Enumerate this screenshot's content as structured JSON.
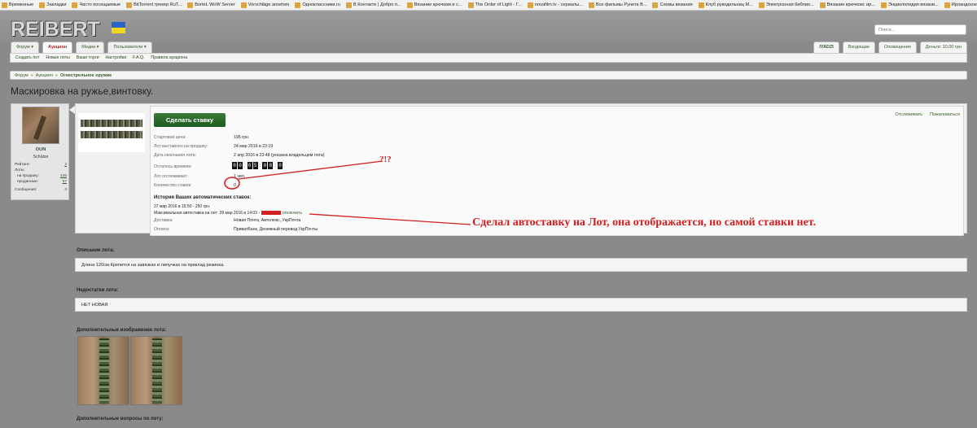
{
  "bookmarks": [
    "Временные",
    "Закладки",
    "Часто посещаемые",
    "BitTorrent трекер RuT...",
    "BorteL WoW Server",
    "Vorschläge ansehen",
    "Одноклассники.ru",
    "В Контакте | Добро п...",
    "Вязание крючком и с...",
    "The Order of Light - Г...",
    "novafilm.tv - сериалы...",
    "Все фильмы Рунета В...",
    "Схемы вязания",
    "Клуб рукодельниц M...",
    "Электронная библио...",
    "Вязание крючком: ир...",
    "Энциклопедия вязани...",
    "Ирландское кружево..."
  ],
  "header": {
    "logo": "REIBERT",
    "logo_small": "info",
    "search_placeholder": "Поиск..."
  },
  "nav": {
    "tabs": [
      "Форум ▾",
      "Аукцион",
      "Медиа ▾",
      "Пользователи ▾"
    ],
    "user": "IYADZI",
    "inbox": "Входящие",
    "alerts": "Оповещения",
    "money": "Деньги: 10,00 грн"
  },
  "subnav": [
    "Создать лот",
    "Новые лоты",
    "Ваши торги",
    "Настройки",
    "F.A.Q.",
    "Правила аукциона"
  ],
  "breadcrumb": {
    "items": [
      "Форум",
      "»",
      "Аукцион",
      "»"
    ],
    "current": "Огнестрельное оружие"
  },
  "page_title": "Маскировка на ружье,винтовку.",
  "user": {
    "name": "OUN",
    "role": "Schütze",
    "stats": [
      {
        "label": "Рейтинг:",
        "value": "2"
      },
      {
        "label": "Лоты:",
        "value": ""
      },
      {
        "label": "на продажу:",
        "value": "136"
      },
      {
        "label": "проданные:",
        "value": "97"
      },
      {
        "label": "Сообщения:",
        "value": "4"
      }
    ]
  },
  "lot": {
    "bid_button": "Сделать ставку",
    "links": [
      "Отслеживать",
      "Пожаловаться"
    ],
    "fields": [
      {
        "label": "Стартовая цена:",
        "value": "195 грн."
      },
      {
        "label": "Лот выставлен на продажу:",
        "value": "24 мар 2016 в 23:19"
      },
      {
        "label": "Дата окончания лота:",
        "value": "2 апр 2016 в 23:48 (указана владельцем лота)"
      },
      {
        "label": "Осталось времени:",
        "value": ""
      },
      {
        "label": "Лот отслеживает:",
        "value": "1 чел."
      },
      {
        "label": "Количество ставок:",
        "value": "0"
      }
    ],
    "timer": [
      "0",
      "0",
      "0",
      "5",
      "0",
      "8",
      "0"
    ],
    "history_title": "История Ваших автоматических ставок:",
    "history": {
      "row1": "27 мар 2016 в 15:50 - 250 грн.",
      "row2_prefix": "Максимальная автоставка на лот: 28 мар 2016 в 14:03 -",
      "row2_link": "отключить"
    },
    "delivery": {
      "label": "Доставка:",
      "value": "Новая Почта, Автолюкс, УкрПочта"
    },
    "payment": {
      "label": "Оплата:",
      "value": "ПриватБанк, Денежный перевод УкрПочты"
    }
  },
  "annotations": {
    "question": "?!?",
    "note": "Сделал автоставку на Лот, она отображается, но самой ставки нет."
  },
  "sections": {
    "desc_title": "Описание лота:",
    "desc": "Длина 120см.Крепится на завязках и липучках на приклад резинка.",
    "flaws_title": "Недостатки лота:",
    "flaws": "НЕТ НОВАЯ",
    "images_title": "Дополнительные изображения лота:",
    "questions_title": "Дополнительные вопросы по лоту:"
  },
  "colors": {
    "accent": "#d21f1f",
    "link": "#3a5a2a",
    "button": "#2b6a2b"
  }
}
